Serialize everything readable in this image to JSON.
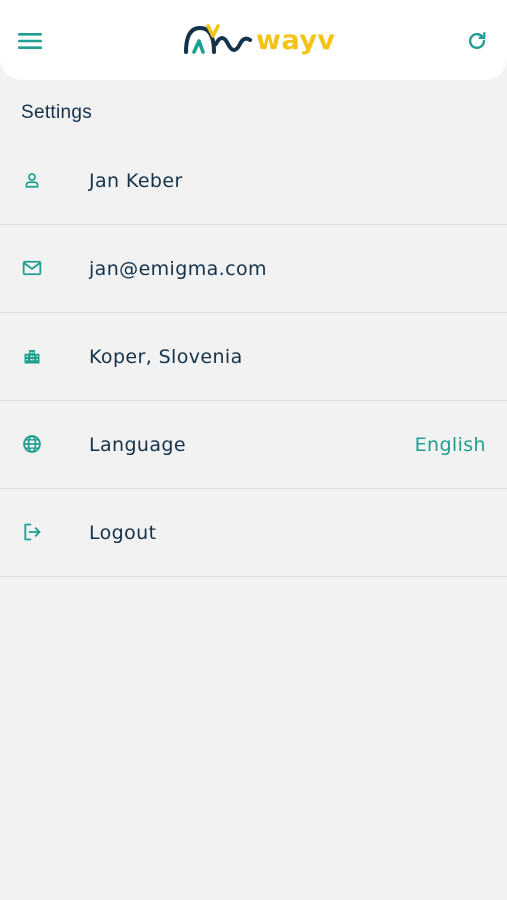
{
  "header": {
    "menu_icon": "hamburger-menu-icon",
    "logo_text": "wayv",
    "refresh_icon": "refresh-icon",
    "brand_teal": "#1f9e91",
    "brand_navy": "#14324a",
    "brand_yellow": "#f4c317"
  },
  "settings": {
    "title": "Settings",
    "items": [
      {
        "icon": "user-icon",
        "label": "Jan Keber",
        "value": ""
      },
      {
        "icon": "mail-icon",
        "label": "jan@emigma.com",
        "value": ""
      },
      {
        "icon": "city-icon",
        "label": "Koper, Slovenia",
        "value": ""
      },
      {
        "icon": "globe-icon",
        "label": "Language",
        "value": "English"
      },
      {
        "icon": "logout-icon",
        "label": "Logout",
        "value": ""
      }
    ]
  }
}
